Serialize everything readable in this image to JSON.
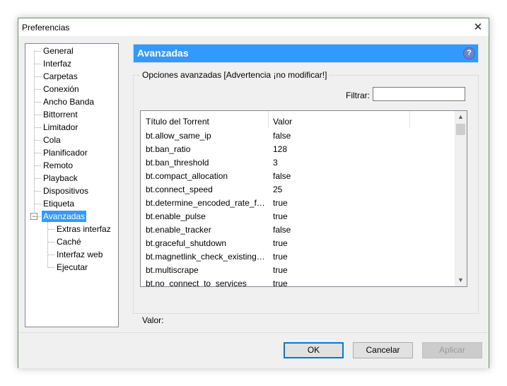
{
  "window": {
    "title": "Preferencias",
    "close_symbol": "✕"
  },
  "tree": {
    "items": [
      "General",
      "Interfaz",
      "Carpetas",
      "Conexión",
      "Ancho Banda",
      "Bittorrent",
      "Limitador",
      "Cola",
      "Planificador",
      "Remoto",
      "Playback",
      "Dispositivos",
      "Etiqueta",
      "Avanzadas"
    ],
    "selected": "Avanzadas",
    "expander_symbol": "−",
    "children": [
      "Extras interfaz",
      "Caché",
      "Interfaz web",
      "Ejecutar"
    ]
  },
  "header": {
    "title": "Avanzadas",
    "help_symbol": "?"
  },
  "group": {
    "label": "Opciones avanzadas [Advertencia ¡no modificar!]"
  },
  "filter": {
    "label": "Filtrar:",
    "value": ""
  },
  "list": {
    "columns": [
      "Título del Torrent",
      "Valor"
    ],
    "rows": [
      {
        "key": "bt.allow_same_ip",
        "value": "false"
      },
      {
        "key": "bt.ban_ratio",
        "value": "128"
      },
      {
        "key": "bt.ban_threshold",
        "value": "3"
      },
      {
        "key": "bt.compact_allocation",
        "value": "false"
      },
      {
        "key": "bt.connect_speed",
        "value": "25"
      },
      {
        "key": "bt.determine_encoded_rate_fo...",
        "value": "true"
      },
      {
        "key": "bt.enable_pulse",
        "value": "true"
      },
      {
        "key": "bt.enable_tracker",
        "value": "false"
      },
      {
        "key": "bt.graceful_shutdown",
        "value": "true"
      },
      {
        "key": "bt.magnetlink_check_existing_...",
        "value": "true"
      },
      {
        "key": "bt.multiscrape",
        "value": "true"
      },
      {
        "key": "bt.no_connect_to_services",
        "value": "true"
      }
    ],
    "scroll_up": "▲",
    "scroll_down": "▼"
  },
  "valor_label": "Valor:",
  "buttons": {
    "ok": "OK",
    "cancel": "Cancelar",
    "apply": "Aplicar"
  }
}
